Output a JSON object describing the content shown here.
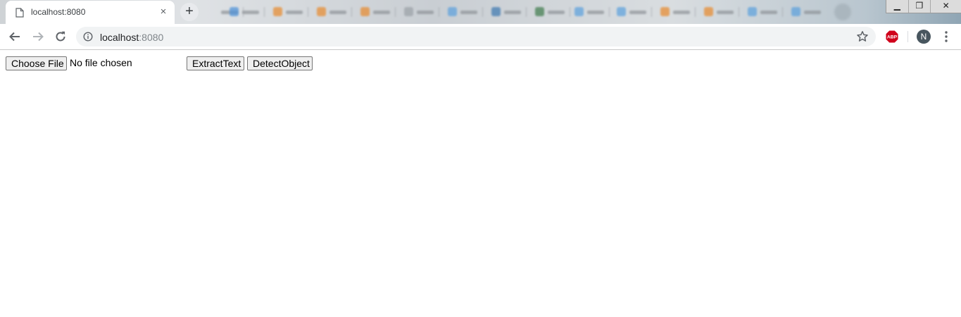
{
  "browser": {
    "active_tab": {
      "title": "localhost:8080",
      "close_glyph": "×"
    },
    "new_tab_glyph": "+",
    "window_controls": {
      "minimize": "▁",
      "restore": "❐",
      "close": "✕"
    },
    "toolbar": {
      "back_icon": "back-arrow-icon",
      "forward_icon": "forward-arrow-icon",
      "reload_icon": "reload-icon",
      "url_host": "localhost",
      "url_port": ":8080",
      "extension_label": "ABP",
      "avatar_initial": "N"
    }
  },
  "page": {
    "choose_file_label": "Choose File",
    "file_status": "No file chosen",
    "extract_text_label": "ExtractText",
    "detect_object_label": "DetectObject"
  },
  "colors": {
    "abp_red": "#d0021b",
    "avatar_bg": "#48565f",
    "button_bg": "#efefef"
  }
}
